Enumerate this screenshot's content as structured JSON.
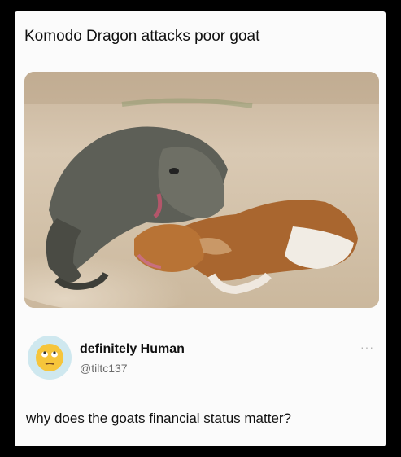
{
  "post": {
    "title": "Komodo Dragon attacks poor goat",
    "photo_alt": "Komodo dragon biting a brown and white goat"
  },
  "author": {
    "display_name": "definitely Human",
    "handle": "@tiltc137",
    "avatar_icon": "eye-roll-emoji-icon"
  },
  "menu": {
    "more_icon": "more-options-icon",
    "more_glyph": "···"
  },
  "reply": {
    "text": "why does the goats financial status matter?"
  }
}
